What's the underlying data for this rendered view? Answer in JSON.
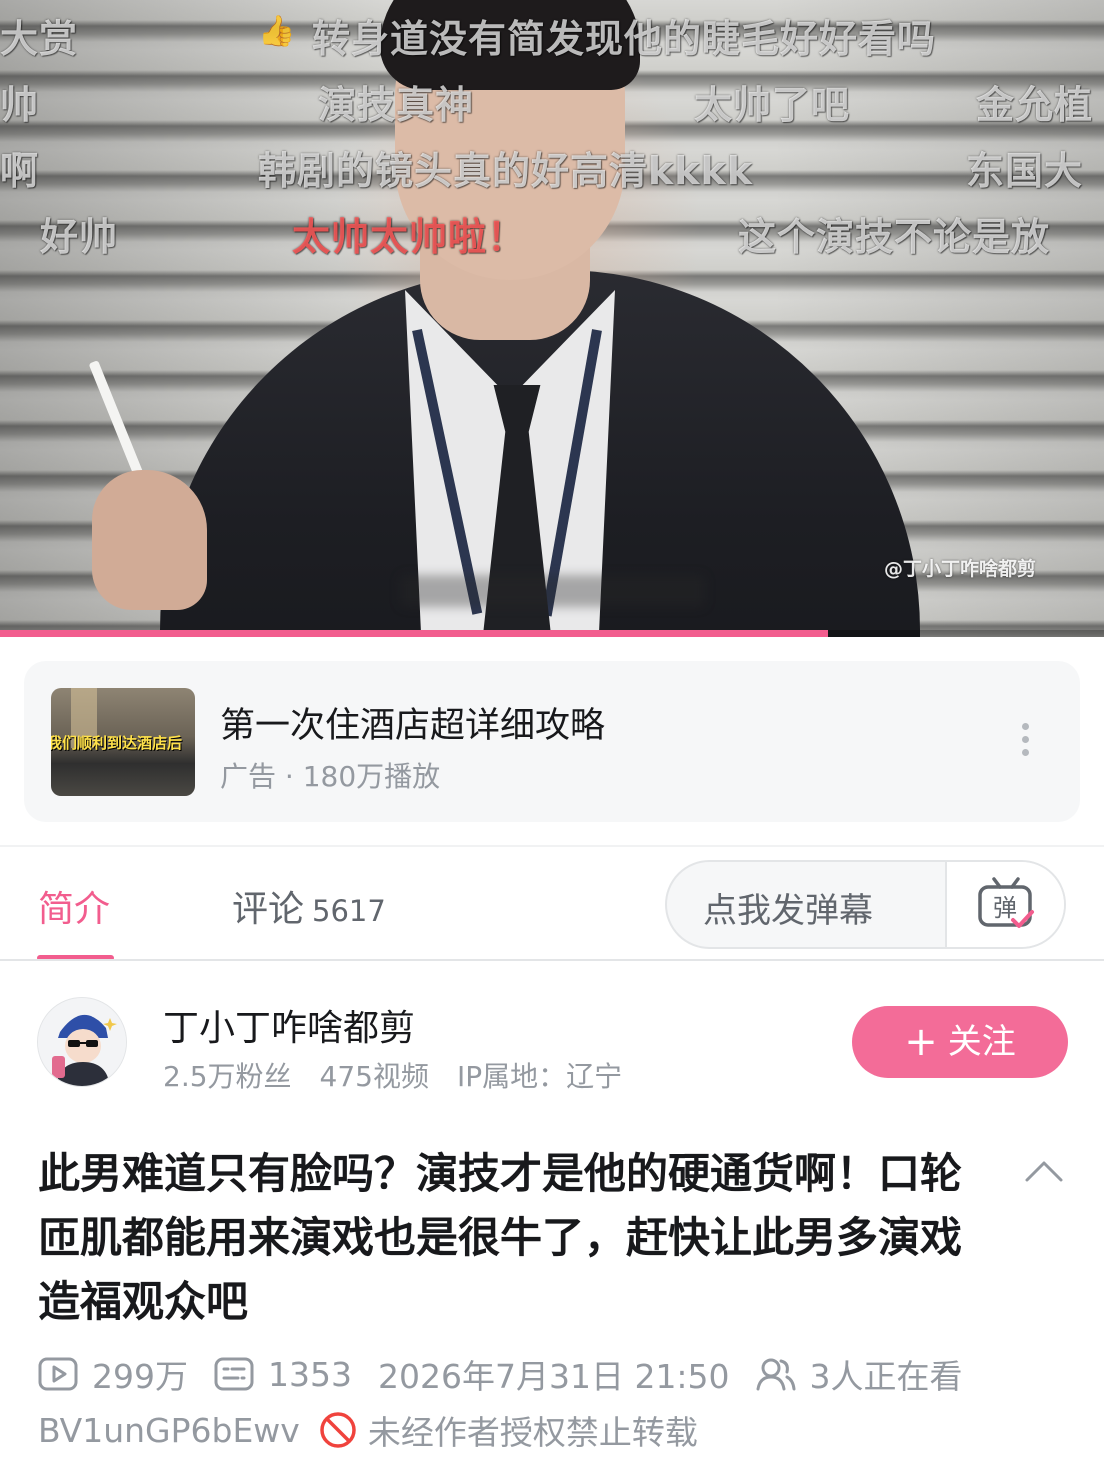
{
  "player": {
    "danmaku": [
      {
        "text": "大赏",
        "color": "white"
      },
      {
        "text": "转身道没有简发现他的睫毛好好看吗",
        "color": "white"
      },
      {
        "text": "帅",
        "color": "white"
      },
      {
        "text": "演技真神",
        "color": "white"
      },
      {
        "text": "太帅了吧",
        "color": "white"
      },
      {
        "text": "金允植",
        "color": "white"
      },
      {
        "text": "啊",
        "color": "white"
      },
      {
        "text": "韩剧的镜头真的好高清kkkk",
        "color": "white"
      },
      {
        "text": "东国大",
        "color": "white"
      },
      {
        "text": "好帅",
        "color": "white"
      },
      {
        "text": "太帅太帅啦！",
        "color": "red"
      },
      {
        "text": "这个演技不论是放",
        "color": "white"
      }
    ],
    "watermark": "@丁小丁咋啥都剪",
    "progress_fraction": 0.75,
    "progress_color": "#f25d8e"
  },
  "ad": {
    "thumb_caption": "我们顺利到达酒店后",
    "title": "第一次住酒店超详细攻略",
    "meta": "广告 · 180万播放",
    "more_icon": "more-vertical-icon"
  },
  "tabs": {
    "intro_label": "简介",
    "comments_label": "评论",
    "comments_count": "5617",
    "danmaku_placeholder": "点我发弹幕",
    "danmaku_icon": "danmaku-toggle-icon",
    "danmaku_icon_char": "弹",
    "accent": "#f25d8e"
  },
  "author": {
    "name": "丁小丁咋啥都剪",
    "fans": "2.5万粉丝",
    "videos": "475视频",
    "ip": "IP属地：辽宁",
    "follow_label": "关注",
    "follow_prefix": "+"
  },
  "video": {
    "title": "此男难道只有脸吗？演技才是他的硬通货啊！口轮匝肌都能用来演戏也是很牛了，赶快让此男多演戏造福观众吧",
    "plays": "299万",
    "danmaku_count": "1353",
    "date": "2026年7月31日 21:50",
    "watching": "3人正在看",
    "bvid": "BV1unGP6bEwv",
    "copyright": "未经作者授权禁止转载"
  }
}
